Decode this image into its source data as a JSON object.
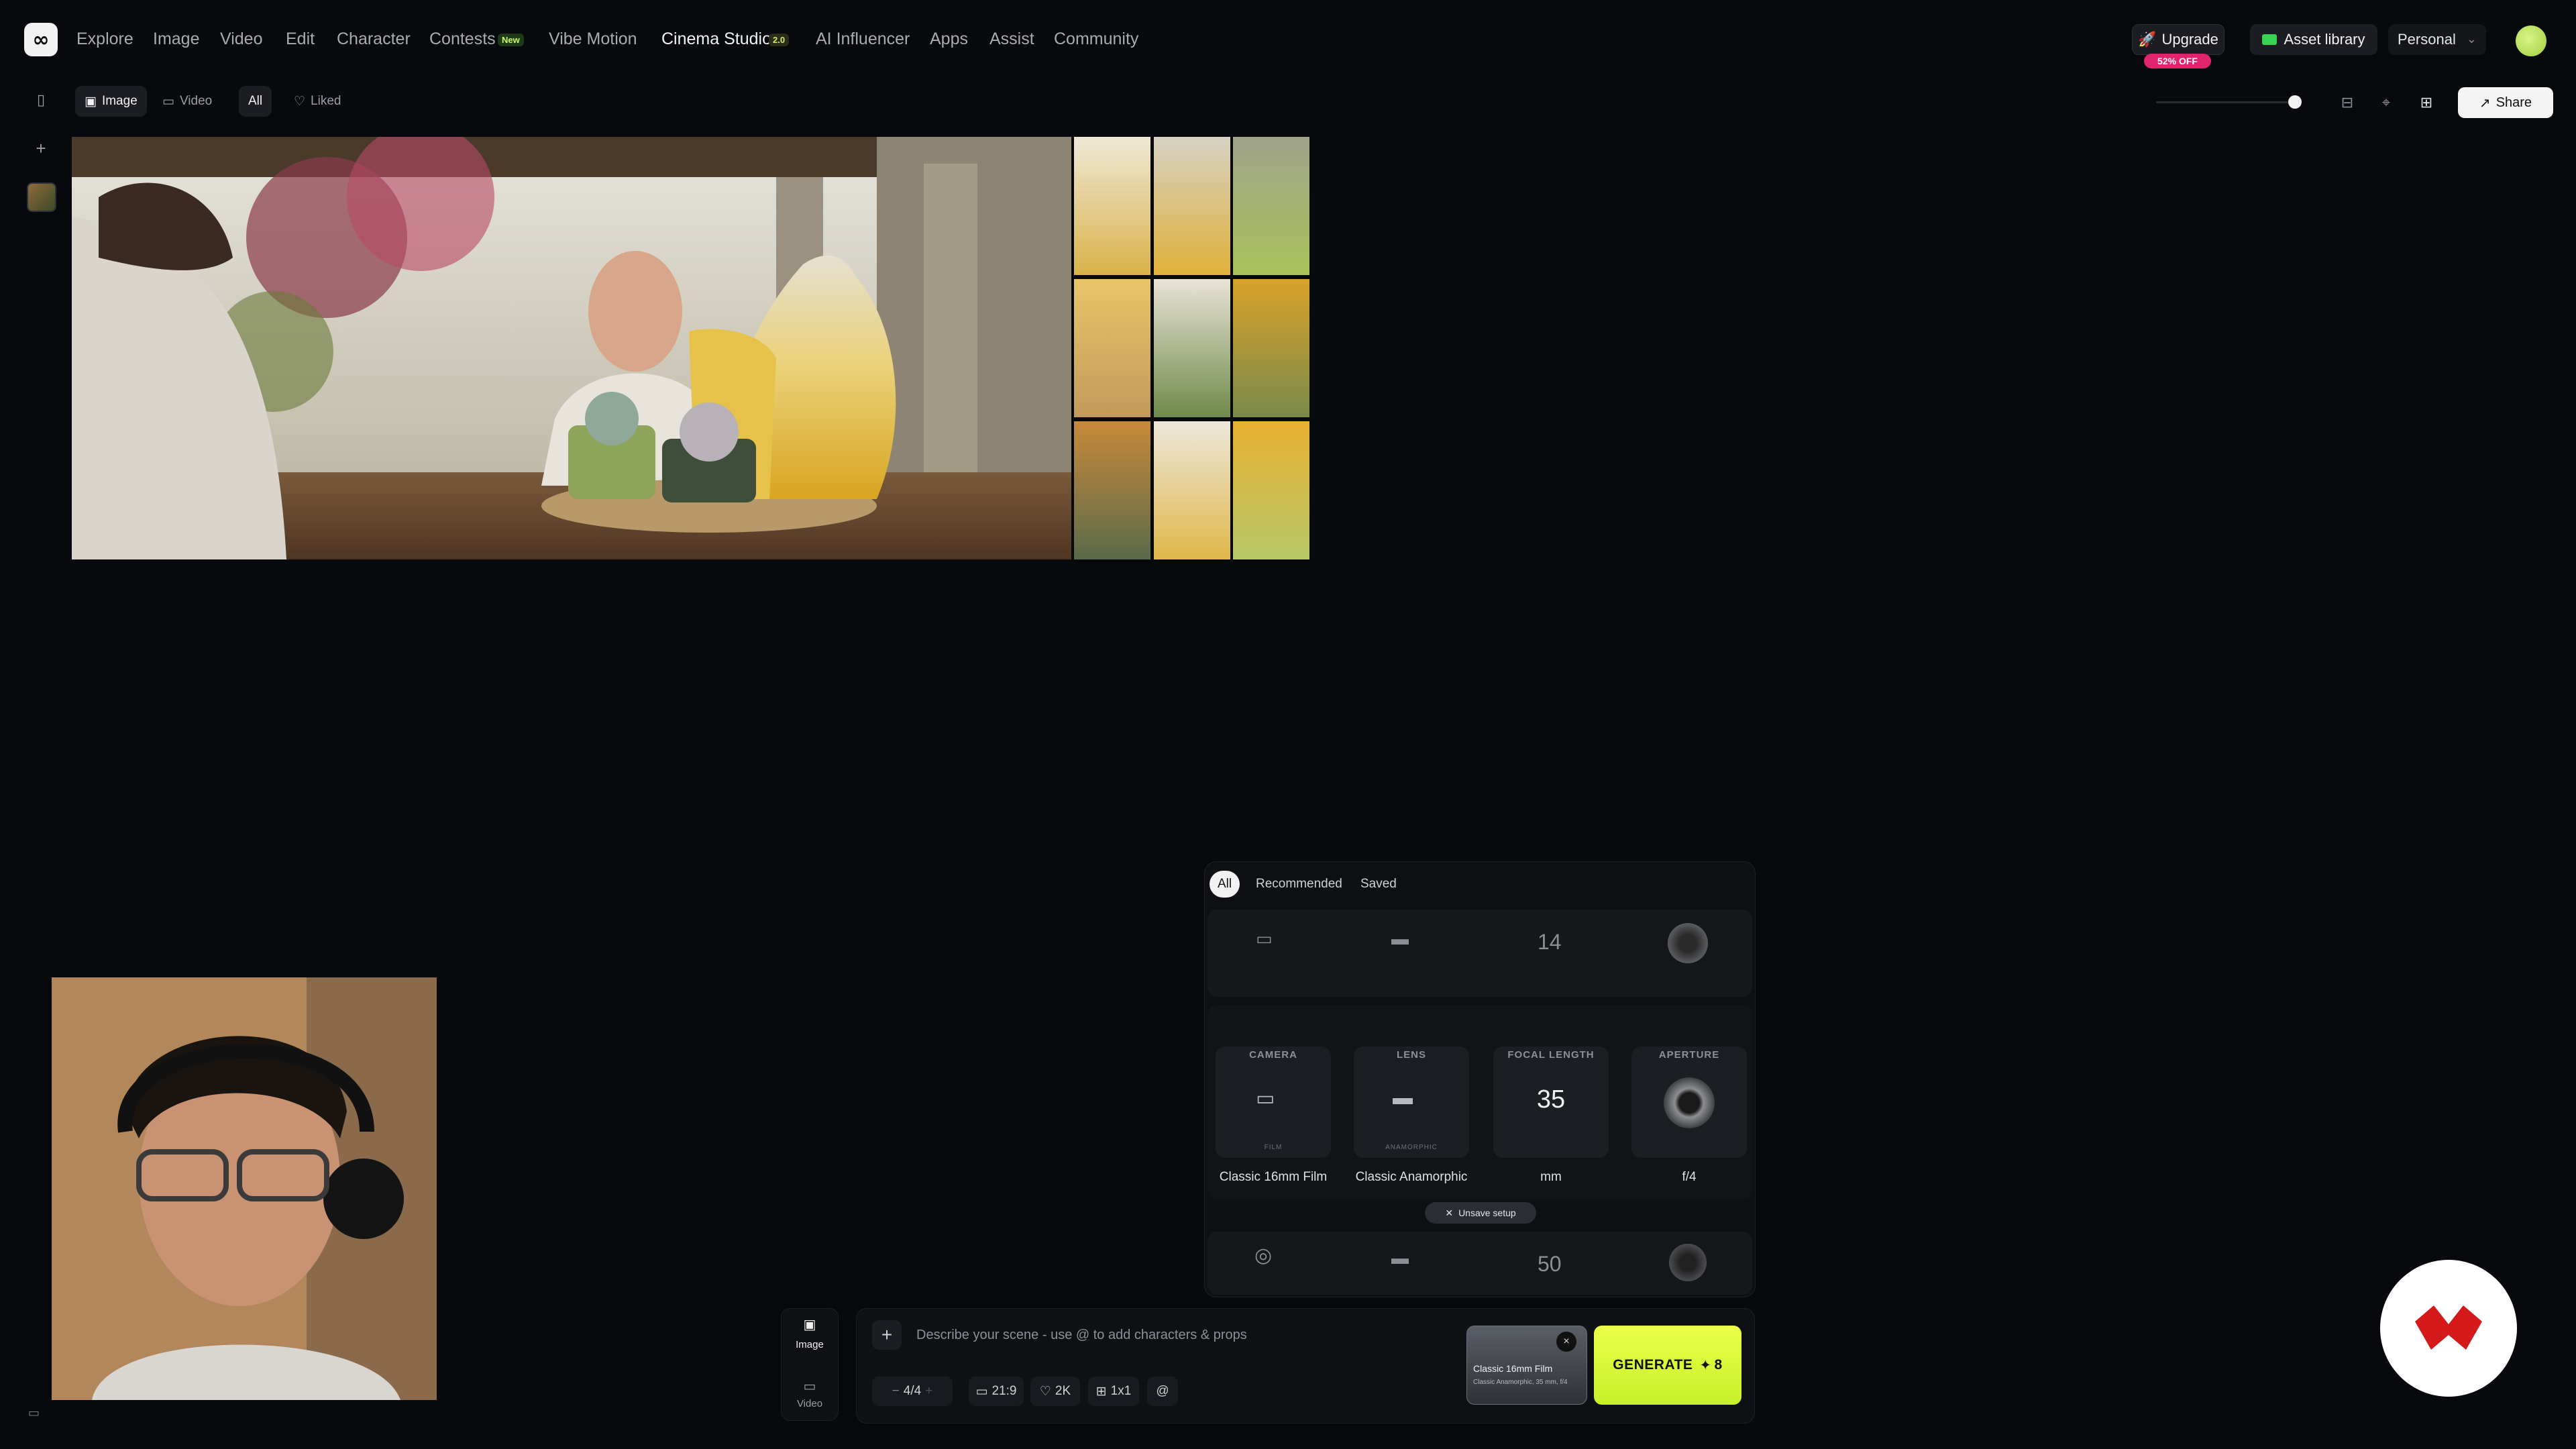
{
  "app": {
    "logo_glyph": "∞",
    "nav": [
      {
        "label": "Explore"
      },
      {
        "label": "Image"
      },
      {
        "label": "Video"
      },
      {
        "label": "Edit"
      },
      {
        "label": "Character"
      },
      {
        "label": "Contests",
        "badge": "New"
      },
      {
        "label": "Vibe Motion"
      },
      {
        "label": "Cinema Studio",
        "badge": "2.0"
      },
      {
        "label": "AI Influencer"
      },
      {
        "label": "Apps"
      },
      {
        "label": "Assist"
      },
      {
        "label": "Community"
      }
    ],
    "upgrade": {
      "label": "Upgrade",
      "discount": "52% OFF"
    },
    "asset_library": "Asset library",
    "workspace": "Personal"
  },
  "toolbar": {
    "tabs": [
      "Image",
      "Video",
      "All",
      "Liked"
    ],
    "share": "Share"
  },
  "setup_panel": {
    "tabs": [
      "All",
      "Recommended",
      "Saved"
    ],
    "top_row": {
      "focal": "14"
    },
    "current": {
      "camera": {
        "title": "CAMERA",
        "tag": "FILM",
        "name": "Classic 16mm Film"
      },
      "lens": {
        "title": "LENS",
        "tag": "ANAMORPHIC",
        "name": "Classic Anamorphic"
      },
      "focal_length": {
        "title": "FOCAL LENGTH",
        "value": "35",
        "unit": "mm"
      },
      "aperture": {
        "title": "APERTURE",
        "value": "f/4"
      }
    },
    "bottom_row": {
      "focal": "50"
    },
    "unsave": "Unsave setup"
  },
  "prompt": {
    "modes": [
      "Image",
      "Video"
    ],
    "placeholder": "Describe your scene - use @ to add characters & props",
    "count": "4/4",
    "aspect": "21:9",
    "resolution": "2K",
    "grid": "1x1",
    "mention": "@",
    "preset": {
      "title": "Classic 16mm Film",
      "subtitle": "Classic Anamorphic, 35 mm, f/4"
    },
    "generate": "GENERATE",
    "cost": "8"
  },
  "colors": {
    "accent": "#d8f53a",
    "upgrade_badge": "#e0256e",
    "background": "#07090c"
  }
}
